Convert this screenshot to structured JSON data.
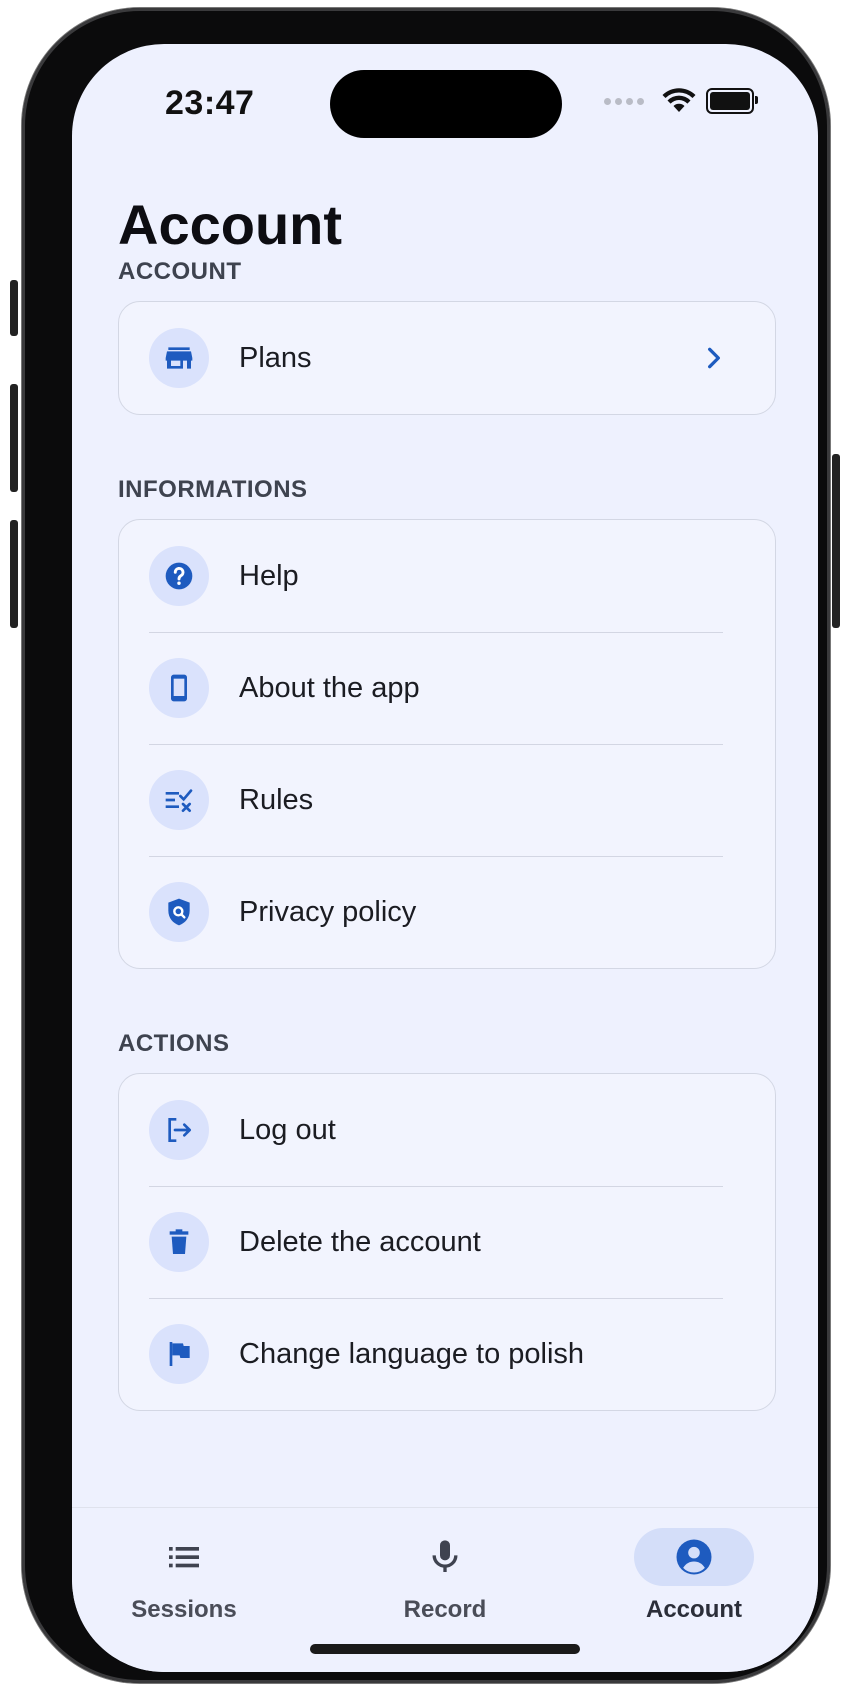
{
  "status_bar": {
    "time": "23:47"
  },
  "page": {
    "title": "Account"
  },
  "colors": {
    "accent": "#1e5bbf",
    "icon_bg": "#dae2fc",
    "background": "#eef1fe",
    "card": "#f2f4fe"
  },
  "sections": [
    {
      "label": "ACCOUNT",
      "items": [
        {
          "label": "Plans",
          "icon": "store-icon",
          "chevron": true
        }
      ]
    },
    {
      "label": "INFORMATIONS",
      "items": [
        {
          "label": "Help",
          "icon": "help-icon"
        },
        {
          "label": "About the app",
          "icon": "phone-icon"
        },
        {
          "label": "Rules",
          "icon": "rules-icon"
        },
        {
          "label": "Privacy policy",
          "icon": "privacy-shield-icon"
        }
      ]
    },
    {
      "label": "ACTIONS",
      "items": [
        {
          "label": "Log out",
          "icon": "logout-icon"
        },
        {
          "label": "Delete the account",
          "icon": "trash-icon"
        },
        {
          "label": "Change language to polish",
          "icon": "flag-icon"
        }
      ]
    }
  ],
  "tabbar": {
    "tabs": [
      {
        "label": "Sessions",
        "icon": "list-icon",
        "active": false
      },
      {
        "label": "Record",
        "icon": "microphone-icon",
        "active": false
      },
      {
        "label": "Account",
        "icon": "account-circle-icon",
        "active": true
      }
    ]
  }
}
